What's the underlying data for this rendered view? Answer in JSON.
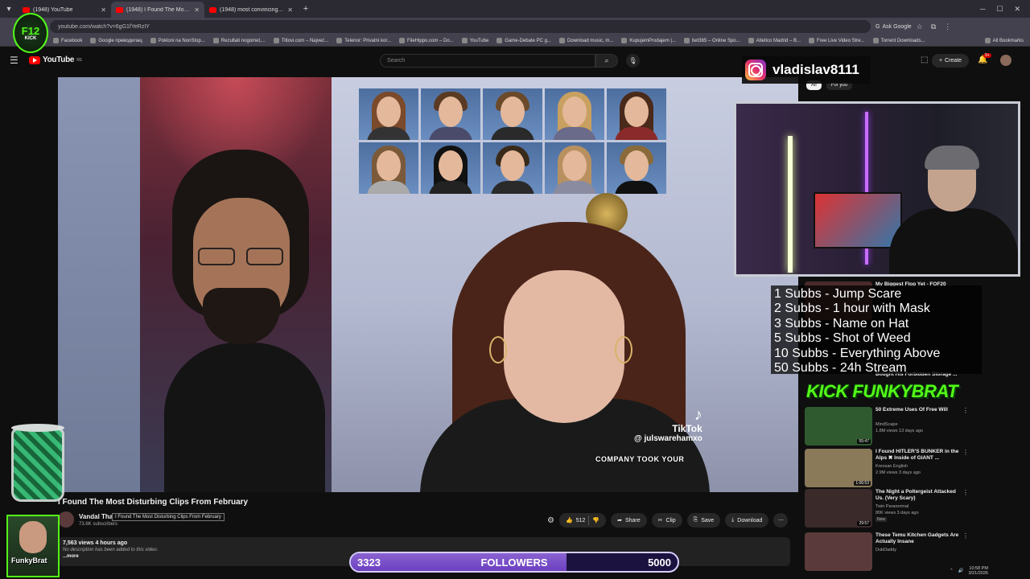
{
  "browser": {
    "tabs": [
      {
        "label": "(1948) YouTube",
        "active": false
      },
      {
        "label": "(1948) I Found The Most D",
        "active": true
      },
      {
        "label": "(1948) most convincing eviden",
        "active": false
      }
    ],
    "url": "youtube.com/watch?v=6gG1fYeRzIY",
    "ask_google": "Ask Google",
    "bookmarks": [
      "Facebook",
      "Google преводилац",
      "Pokloni na NonStop...",
      "Rezultati nogomet,...",
      "Titlovi.com – Najveć...",
      "Telenor: Privatni kor...",
      "FileHippo.com – Do...",
      "YouTube",
      "Game-Debate PC g...",
      "Download music, m...",
      "KupujemProdajem |...",
      "bet365 – Online Spo...",
      "Atletico Madrid – B...",
      "Free Live Video Stre...",
      "Torrent Downloads..."
    ],
    "all_bookmarks": "All Bookmarks"
  },
  "youtube": {
    "logo_text": "YouTube",
    "region": "RS",
    "search_placeholder": "Search",
    "create_label": "Create",
    "notif_count": "9+"
  },
  "video": {
    "title": "I Found The Most Disturbing Clips From February",
    "channel": "Vandal Tha",
    "subscribers": "73.6K subscribers",
    "tooltip": "I Found The Most Disturbing Clips From February",
    "likes": "512",
    "share": "Share",
    "clip": "Clip",
    "save": "Save",
    "download": "Download",
    "views_meta": "7,563 views  4 hours ago",
    "description": "No description has been added to this video.",
    "more": "...more",
    "overlay_tiktok": "TikTok",
    "overlay_handle": "@ julswarehamxo",
    "overlay_caption": "COMPANY TOOK YOUR"
  },
  "sidebar": {
    "chips": [
      "All",
      "For you"
    ],
    "recommendations": [
      {
        "title": "I Found HITLER'S BUNKER in the Alps ✖ Inside of GIANT ...",
        "channel": "Kreosan English",
        "meta": "2.9M views  3 days ago",
        "duration": "1:06:53",
        "thumb": "#8a7a5a"
      },
      {
        "title": "The Night a Poltergeist Attacked Us. (Very Scary)",
        "channel": "Twin Paranormal",
        "meta": "80K views  3 days ago",
        "badge": "New",
        "duration": "29:57",
        "thumb": "#3a2a2a"
      },
      {
        "title": "These Temu Kitchen Gadgets Are Actually Insane",
        "channel": "DubDaddy",
        "meta": "",
        "duration": "",
        "thumb": "#5a3a3a"
      }
    ],
    "rec_top": {
      "title": "50 Extreme Uses Of Free Will",
      "channel": "MindScape",
      "meta": "1.8M views  13 days ago",
      "duration": "55:47",
      "thumb": "#2f5a2f"
    },
    "rec_hidden_top": "My Biggest Flop Yet - FOF20",
    "rec_hidden_mid": "Bought His Forbidden Storage ..."
  },
  "stream": {
    "logo_top": "F12",
    "logo_bottom": "KICK",
    "instagram": "vladislav8111",
    "goals": [
      "1 Subbs - Jump Scare",
      "2 Subbs - 1 hour with Mask",
      "3 Subbs - Name on Hat",
      "5 Subbs - Shot of Weed",
      "10 Subbs - Everything Above",
      "50 Subbs - 24h Stream"
    ],
    "kick_banner": "KICK FUNKYBRAT",
    "avatar_name": "FunkyBrat",
    "followers_count": "3323",
    "followers_label": "FOLLOWERS",
    "followers_goal": "5000",
    "followers_progress": 0.66
  },
  "taskbar": {
    "time": "10:58 PM",
    "date": "3/21/2026"
  }
}
